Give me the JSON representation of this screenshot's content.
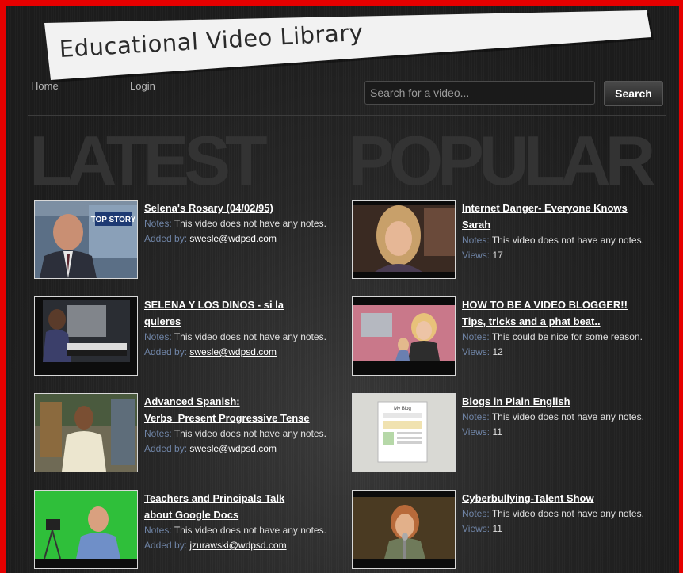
{
  "header": {
    "title": "Educational Video Library"
  },
  "nav": {
    "home": "Home",
    "login": "Login"
  },
  "search": {
    "placeholder": "Search for a video...",
    "button": "Search"
  },
  "sections": {
    "latest": "LATEST",
    "popular": "POPULAR"
  },
  "labels": {
    "notes": "Notes:",
    "added_by": "Added by:",
    "views": "Views:"
  },
  "latest": [
    {
      "title_lines": [
        "Selena's Rosary (04/02/95)"
      ],
      "notes": "This video does not have any notes.",
      "added_by": "swesle@wdpsd.com",
      "thumb": "news-anchor-thumbnail",
      "thumb_overlay": "TOP STORY"
    },
    {
      "title_lines": [
        "SELENA Y LOS DINOS - si la",
        "quieres"
      ],
      "notes": "This video does not have any notes.",
      "added_by": "swesle@wdpsd.com",
      "thumb": "keyboard-player-thumbnail"
    },
    {
      "title_lines": [
        "Advanced Spanish:",
        "Verbs_Present Progressive Tense"
      ],
      "notes": "This video does not have any notes.",
      "added_by": "swesle@wdpsd.com",
      "thumb": "teacher-workshop-thumbnail"
    },
    {
      "title_lines": [
        "Teachers and Principals Talk",
        "about Google Docs"
      ],
      "notes": "This video does not have any notes.",
      "added_by": "jzurawski@wdpsd.com",
      "thumb": "greenscreen-interview-thumbnail"
    }
  ],
  "popular": [
    {
      "title_lines": [
        "Internet Danger- Everyone Knows",
        "Sarah"
      ],
      "notes": "This video does not have any notes.",
      "views": "17",
      "thumb": "girl-portrait-thumbnail"
    },
    {
      "title_lines": [
        "HOW TO BE A VIDEO BLOGGER!!",
        "Tips, tricks and a phat beat.."
      ],
      "notes": "This could be nice for some reason.",
      "views": "12",
      "thumb": "video-blogger-thumbnail"
    },
    {
      "title_lines": [
        "Blogs in Plain English"
      ],
      "notes": "This video does not have any notes.",
      "views": "11",
      "thumb": "paper-blog-thumbnail",
      "thumb_overlay": "My Blog"
    },
    {
      "title_lines": [
        "Cyberbullying-Talent Show"
      ],
      "notes": "This video does not have any notes.",
      "views": "11",
      "thumb": "singer-microphone-thumbnail"
    }
  ],
  "colors": {
    "frame": "#e60000",
    "label_blue": "#6f84a6",
    "banner": "#f2f2f2"
  }
}
